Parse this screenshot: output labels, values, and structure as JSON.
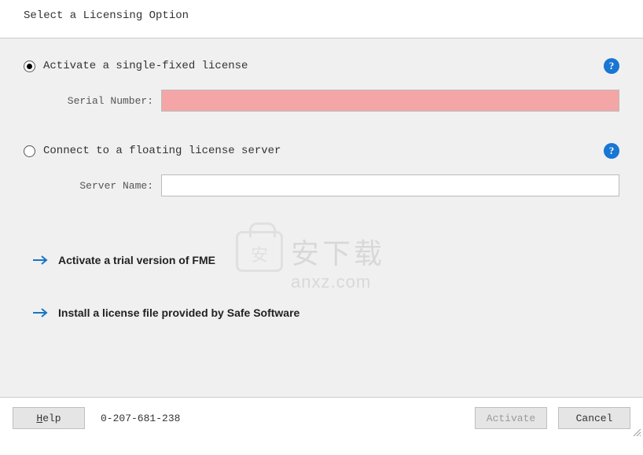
{
  "header": {
    "title": "Select a Licensing Option"
  },
  "option1": {
    "label": "Activate a single-fixed license",
    "field_label": "Serial Number:",
    "field_value": "",
    "selected": true
  },
  "option2": {
    "label": "Connect to a floating license server",
    "field_label": "Server Name:",
    "field_value": "",
    "selected": false
  },
  "links": {
    "trial": "Activate a trial version of FME",
    "install_file": "Install a license file provided by Safe Software"
  },
  "footer": {
    "help": "Help",
    "license_code": "0-207-681-238",
    "activate": "Activate",
    "cancel": "Cancel"
  },
  "help_icon_glyph": "?",
  "watermark": {
    "cn": "安下载",
    "en": "anxz.com"
  }
}
